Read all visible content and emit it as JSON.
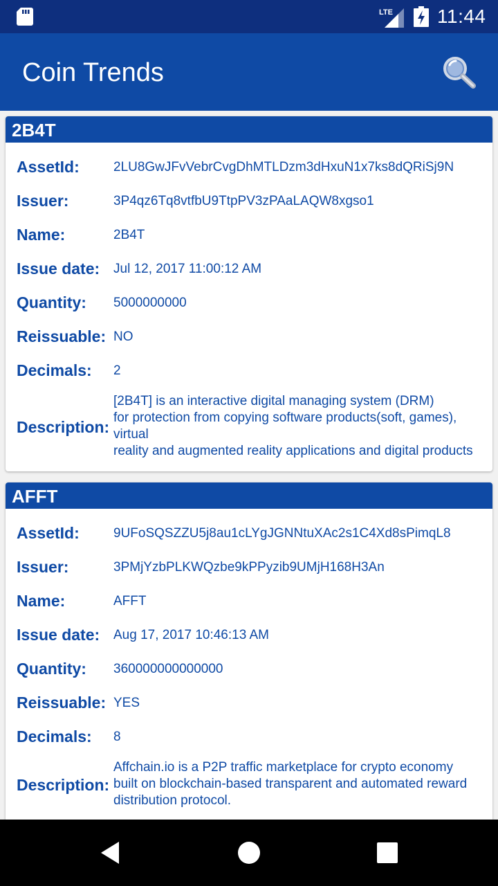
{
  "status_bar": {
    "network": "LTE",
    "time": "11:44"
  },
  "app_bar": {
    "title": "Coin Trends",
    "search_icon": "search-icon"
  },
  "labels": {
    "asset_id": "AssetId:",
    "issuer": "Issuer:",
    "name": "Name:",
    "issue_date": "Issue date:",
    "quantity": "Quantity:",
    "reissuable": "Reissuable:",
    "decimals": "Decimals:",
    "description": "Description:"
  },
  "coins": [
    {
      "header": "2B4T",
      "asset_id": "2LU8GwJFvVebrCvgDhMTLDzm3dHxuN1x7ks8dQRiSj9N",
      "issuer": "3P4qz6Tq8vtfbU9TtpPV3zPAaLAQW8xgso1",
      "name": "2B4T",
      "issue_date": "Jul 12, 2017 11:00:12 AM",
      "quantity": "5000000000",
      "reissuable": "NO",
      "decimals": "2",
      "description_lines": [
        "[2B4T] is an interactive digital managing system (DRM)",
        "for protection from copying software products(soft, games),",
        "virtual",
        "reality and augmented reality applications and digital products"
      ]
    },
    {
      "header": "AFFT",
      "asset_id": "9UFoSQSZZU5j8au1cLYgJGNNtuXAc2s1C4Xd8sPimqL8",
      "issuer": "3PMjYzbPLKWQzbe9kPPyzib9UMjH168H3An",
      "name": "AFFT",
      "issue_date": "Aug 17, 2017 10:46:13 AM",
      "quantity": "360000000000000",
      "reissuable": "YES",
      "decimals": "8",
      "description_lines": [
        "Affchain.io is a P2P traffic marketplace for crypto economy",
        "built on blockchain-based transparent and automated reward",
        "distribution protocol."
      ]
    }
  ],
  "nav_bar": {
    "back_icon": "back-icon",
    "home_icon": "home-icon",
    "recents_icon": "recents-icon"
  },
  "colors": {
    "status_bar": "#0e2f7e",
    "primary": "#0f4aa5",
    "background": "#f1f1f1"
  }
}
